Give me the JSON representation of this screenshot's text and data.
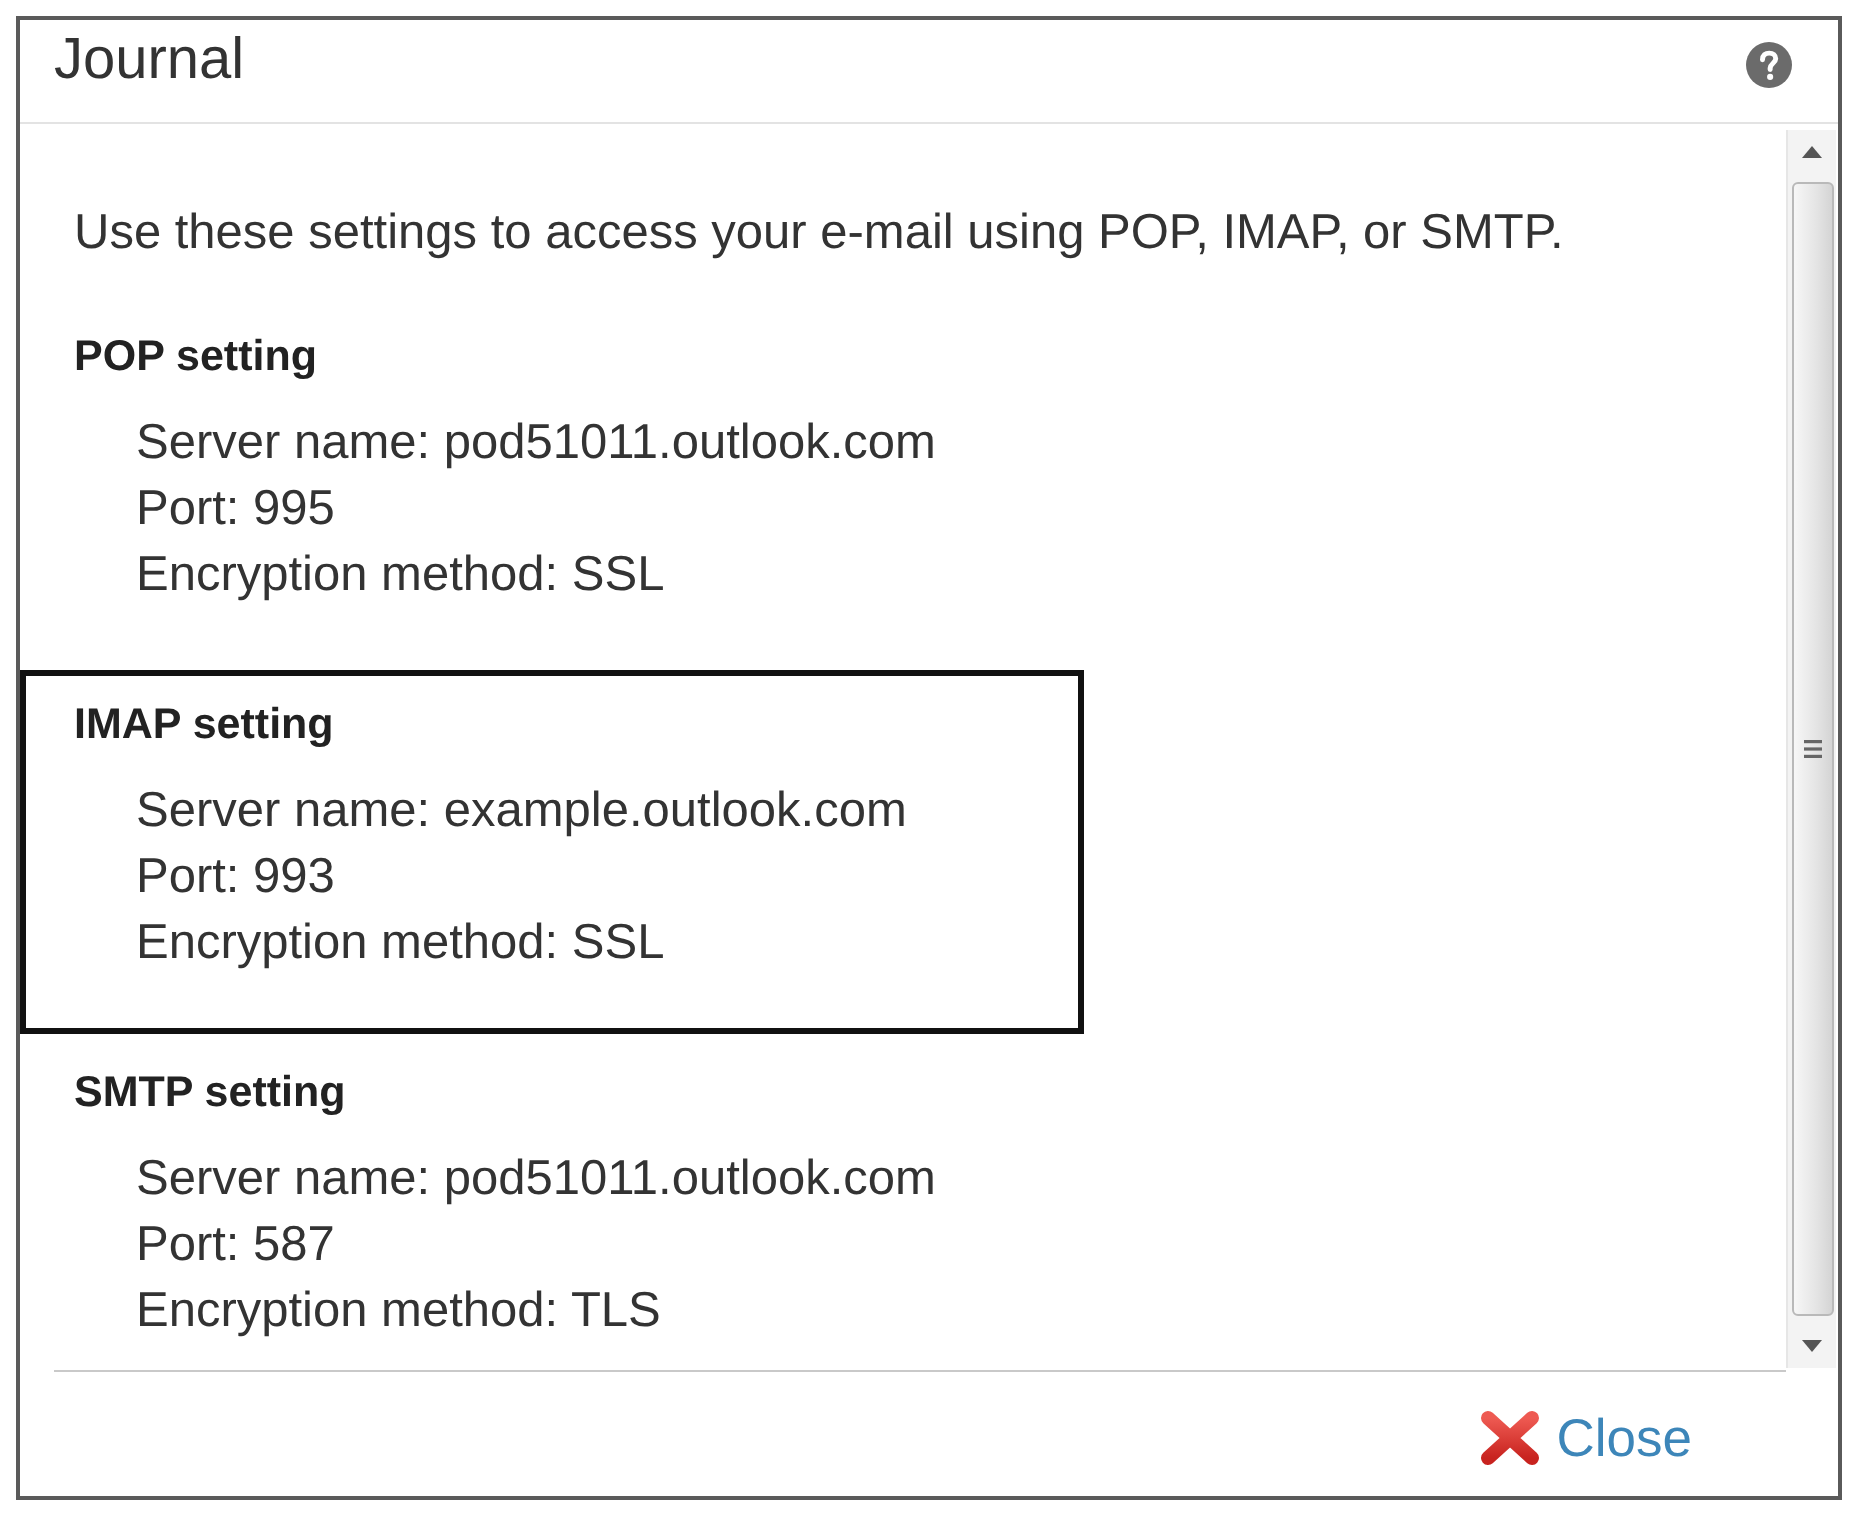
{
  "window": {
    "title": "Journal"
  },
  "intro": "Use these settings to access your e-mail using POP, IMAP, or SMTP.",
  "sections": [
    {
      "heading": "POP setting",
      "highlighted": false,
      "lines": [
        "Server name: pod51011.outlook.com",
        "Port: 995",
        "Encryption method: SSL"
      ]
    },
    {
      "heading": "IMAP setting",
      "highlighted": true,
      "lines": [
        "Server name: example.outlook.com",
        "Port: 993",
        "Encryption method: SSL"
      ]
    },
    {
      "heading": "SMTP setting",
      "highlighted": false,
      "lines": [
        "Server name: pod51011.outlook.com",
        "Port: 587",
        "Encryption method: TLS"
      ]
    }
  ],
  "footer": {
    "close_button": "Close"
  }
}
